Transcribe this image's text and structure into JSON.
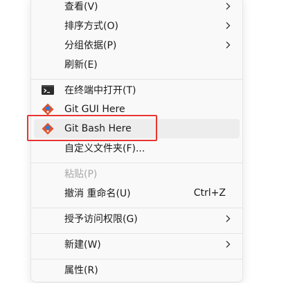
{
  "context_menu": {
    "items": [
      {
        "label": "查看(V)",
        "submenu": true
      },
      {
        "label": "排序方式(O)",
        "submenu": true
      },
      {
        "label": "分组依据(P)",
        "submenu": true
      },
      {
        "label": "刷新(E)"
      },
      {
        "label": "在终端中打开(T)",
        "icon": "terminal-icon"
      },
      {
        "label": "Git GUI Here",
        "icon": "git-icon"
      },
      {
        "label": "Git Bash Here",
        "icon": "git-icon",
        "highlighted": true
      },
      {
        "label": "自定义文件夹(F)..."
      },
      {
        "label": "粘贴(P)",
        "disabled": true
      },
      {
        "label": "撤消 重命名(U)",
        "shortcut": "Ctrl+Z"
      },
      {
        "label": "授予访问权限(G)",
        "submenu": true
      },
      {
        "label": "新建(W)",
        "submenu": true
      },
      {
        "label": "属性(R)"
      }
    ]
  },
  "colors": {
    "menu_bg": "#f9f9f9",
    "hover_bg": "#ededed",
    "annotation_red": "#e8342f",
    "disabled_text": "#a8a8a8",
    "git_orange": "#e4522c",
    "git_blue": "#2d7ad6"
  }
}
